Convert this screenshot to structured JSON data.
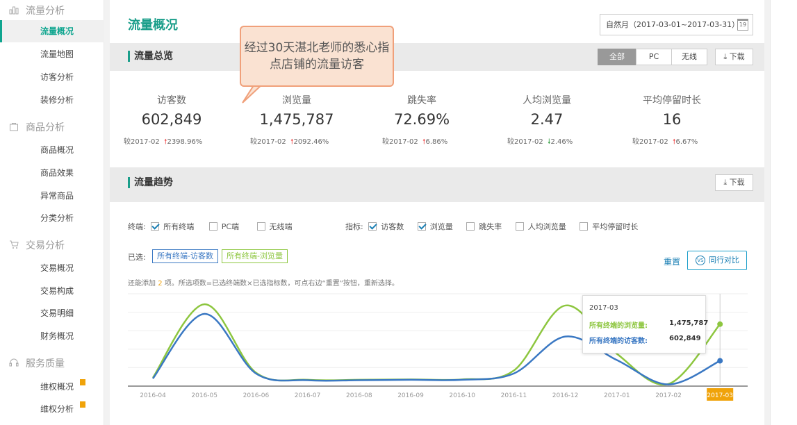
{
  "sidebar": {
    "sections": [
      {
        "title": "流量分析",
        "icon": "bar-chart-icon",
        "items": [
          "流量概况",
          "流量地图",
          "访客分析",
          "装修分析"
        ]
      },
      {
        "title": "商品分析",
        "icon": "bag-icon",
        "items": [
          "商品概况",
          "商品效果",
          "异常商品",
          "分类分析"
        ]
      },
      {
        "title": "交易分析",
        "icon": "cart-icon",
        "items": [
          "交易概况",
          "交易构成",
          "交易明细",
          "财务概况"
        ]
      },
      {
        "title": "服务质量",
        "icon": "headset-icon",
        "items": [
          "维权概况",
          "维权分析"
        ]
      }
    ],
    "active": "流量概况"
  },
  "header": {
    "title": "流量概况",
    "date_range": "自然月（2017-03-01~2017-03-31）",
    "calendar_day": "19"
  },
  "overview": {
    "title": "流量总览",
    "segments": [
      "全部",
      "PC",
      "无线"
    ],
    "active_segment": "全部",
    "download_label": "下载",
    "metrics": [
      {
        "label": "访客数",
        "value": "602,849",
        "compare": "较2017-02",
        "change": "2398.96%",
        "trend": "up"
      },
      {
        "label": "浏览量",
        "value": "1,475,787",
        "compare": "较2017-02",
        "change": "2092.46%",
        "trend": "up"
      },
      {
        "label": "跳失率",
        "value": "72.69%",
        "compare": "较2017-02",
        "change": "6.86%",
        "trend": "up"
      },
      {
        "label": "人均浏览量",
        "value": "2.47",
        "compare": "较2017-02",
        "change": "2.46%",
        "trend": "down"
      },
      {
        "label": "平均停留时长",
        "value": "16",
        "compare": "较2017-02",
        "change": "6.67%",
        "trend": "up"
      }
    ]
  },
  "trend": {
    "title": "流量趋势",
    "download_label": "下载",
    "terminal_label": "终端:",
    "terminals": [
      {
        "label": "所有终端",
        "checked": true
      },
      {
        "label": "PC端",
        "checked": false
      },
      {
        "label": "无线端",
        "checked": false
      }
    ],
    "indicator_label": "指标:",
    "indicators": [
      {
        "label": "访客数",
        "checked": true
      },
      {
        "label": "浏览量",
        "checked": true
      },
      {
        "label": "跳失率",
        "checked": false
      },
      {
        "label": "人均浏览量",
        "checked": false
      },
      {
        "label": "平均停留时长",
        "checked": false
      }
    ],
    "selected_label": "已选:",
    "chips": [
      "所有终端-访客数",
      "所有终端-浏览量"
    ],
    "reset_label": "重置",
    "peer_label": "同行对比",
    "hint_prefix": "还能添加",
    "hint_count": "2",
    "hint_suffix": "项。所选项数=已选终端数×已选指标数，可点右边“重置”按钮，重新选择。",
    "tooltip": {
      "date": "2017-03",
      "rows": [
        {
          "label": "所有终端的浏览量:",
          "value": "1,475,787"
        },
        {
          "label": "所有终端的访客数:",
          "value": "602,849"
        }
      ]
    }
  },
  "callout_text": "经过30天湛北老师的悉心指点店铺的流量访客",
  "colors": {
    "accent": "#1a9e8a",
    "series_pv": "#8dc63f",
    "series_uv": "#3a78c3",
    "highlight": "#f0a30a"
  },
  "chart_data": {
    "type": "line",
    "categories": [
      "2016-04",
      "2016-05",
      "2016-06",
      "2016-07",
      "2016-08",
      "2016-09",
      "2016-10",
      "2016-11",
      "2016-12",
      "2017-01",
      "2017-02",
      "2017-03"
    ],
    "series": [
      {
        "name": "所有终端的浏览量",
        "color": "#8dc63f",
        "values": [
          200000,
          1950000,
          320000,
          150000,
          150000,
          160000,
          160000,
          370000,
          1920000,
          770000,
          50000,
          1475787
        ]
      },
      {
        "name": "所有终端的访客数",
        "color": "#3a78c3",
        "values": [
          180000,
          1720000,
          300000,
          140000,
          140000,
          150000,
          150000,
          300000,
          1180000,
          620000,
          40000,
          602849
        ]
      }
    ],
    "ylim": [
      0,
      2200000
    ],
    "highlight_category": "2017-03",
    "grid": true
  }
}
